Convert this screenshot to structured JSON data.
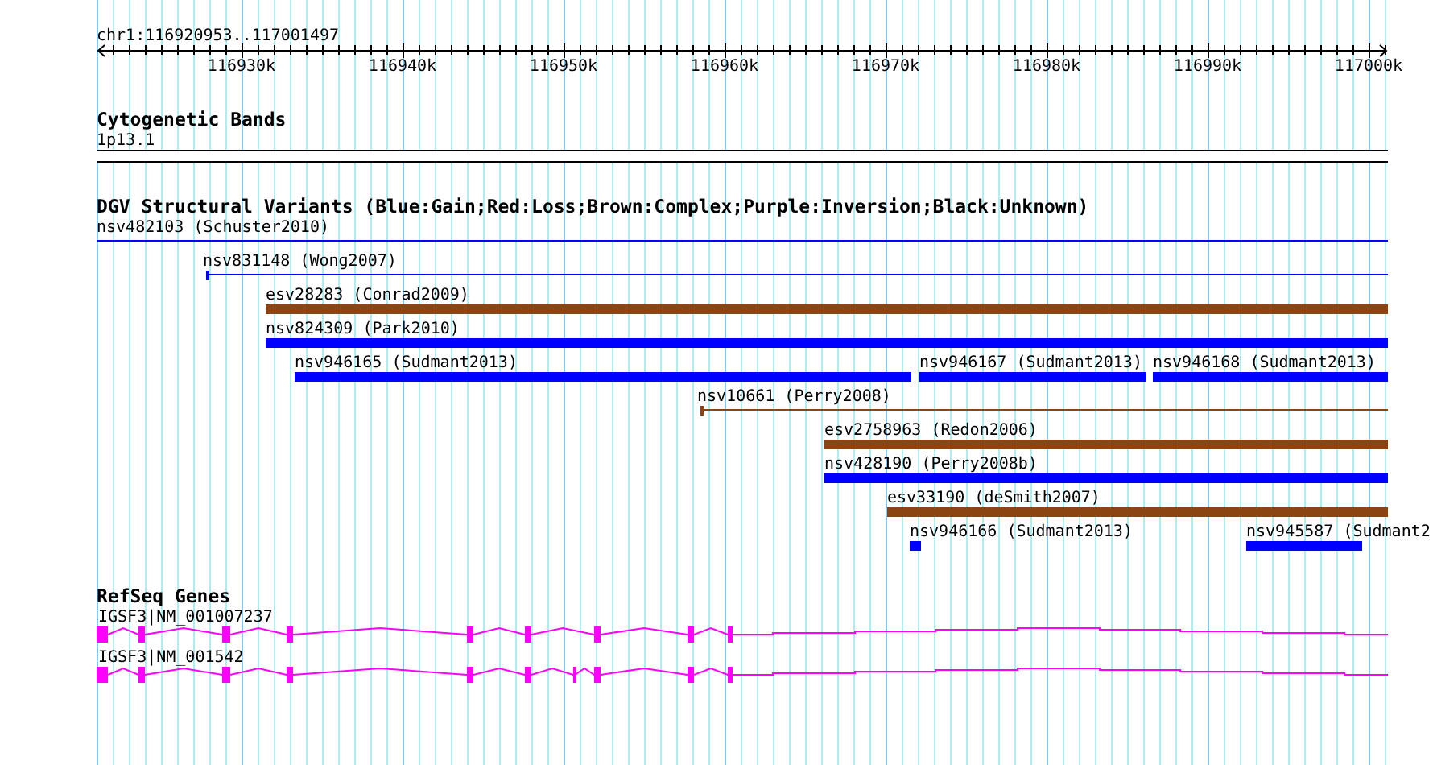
{
  "ruler": {
    "range": "chr1:116920953..117001497",
    "ticks": [
      "116930k",
      "116940k",
      "116950k",
      "116960k",
      "116970k",
      "116980k",
      "116990k",
      "117000k"
    ]
  },
  "cytogenetic_bands": {
    "title": "Cytogenetic Bands",
    "band": "1p13.1"
  },
  "dgv_track": {
    "title": "DGV Structural Variants (Blue:Gain;Red:Loss;Brown:Complex;Purple:Inversion;Black:Unknown)",
    "variants": [
      {
        "label": "nsv482103 (Schuster2010)",
        "kind": "line",
        "color": "#0000ff"
      },
      {
        "label": "nsv831148 (Wong2007)",
        "kind": "line",
        "color": "#0000ff"
      },
      {
        "label": "esv28283 (Conrad2009)",
        "kind": "bar",
        "color": "#8b4513"
      },
      {
        "label": "nsv824309 (Park2010)",
        "kind": "bar",
        "color": "#0000ff"
      },
      {
        "label": "nsv946165 (Sudmant2013)",
        "kind": "bar",
        "color": "#0000ff"
      },
      {
        "label": "nsv946167 (Sudmant2013)",
        "kind": "bar",
        "color": "#0000ff"
      },
      {
        "label": "nsv946168 (Sudmant2013)",
        "kind": "bar",
        "color": "#0000ff"
      },
      {
        "label": "nsv10661 (Perry2008)",
        "kind": "line",
        "color": "#8b4513"
      },
      {
        "label": "esv2758963 (Redon2006)",
        "kind": "bar",
        "color": "#8b4513"
      },
      {
        "label": "nsv428190 (Perry2008b)",
        "kind": "bar",
        "color": "#0000ff"
      },
      {
        "label": "esv33190 (deSmith2007)",
        "kind": "bar",
        "color": "#8b4513"
      },
      {
        "label": "nsv946166 (Sudmant2013)",
        "kind": "bar",
        "color": "#0000ff"
      },
      {
        "label": "nsv945587 (Sudmant2",
        "kind": "bar",
        "color": "#0000ff"
      }
    ]
  },
  "refseq_track": {
    "title": "RefSeq Genes",
    "genes": [
      {
        "label": "IGSF3|NM_001007237"
      },
      {
        "label": "IGSF3|NM_001542"
      }
    ]
  }
}
